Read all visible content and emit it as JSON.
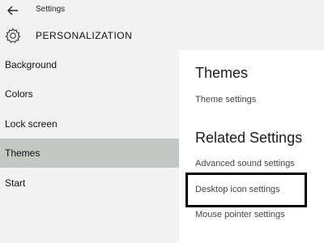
{
  "titlebar": {
    "title": "Settings"
  },
  "header": {
    "title": "PERSONALIZATION"
  },
  "sidebar": {
    "items": [
      {
        "label": "Background"
      },
      {
        "label": "Colors"
      },
      {
        "label": "Lock screen"
      },
      {
        "label": "Themes",
        "selected": true
      },
      {
        "label": "Start"
      }
    ]
  },
  "content": {
    "themes_heading": "Themes",
    "theme_settings": "Theme settings",
    "related_heading": "Related Settings",
    "advanced_sound": "Advanced sound settings",
    "desktop_icon": "Desktop icon settings",
    "mouse_pointer": "Mouse pointer settings"
  },
  "icons": {
    "back": "back-arrow-icon",
    "settings": "gear-icon"
  },
  "colors": {
    "sidebar_bg": "#f2f2f2",
    "selected_bg": "#c4c8c4",
    "highlight_border": "#000000"
  }
}
